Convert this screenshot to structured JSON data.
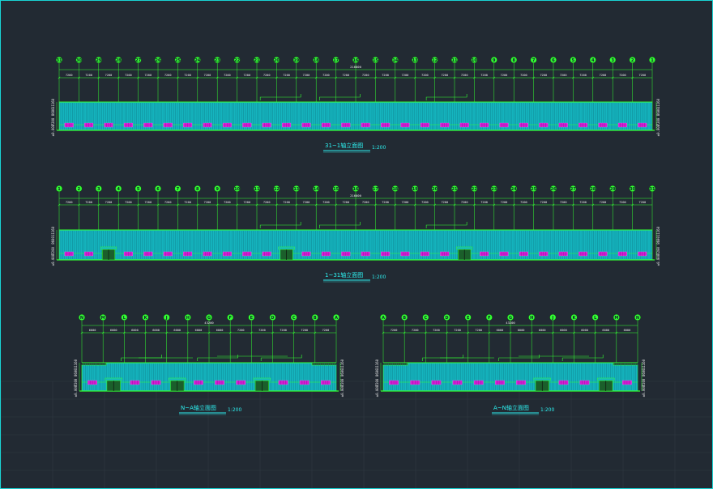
{
  "colors": {
    "background": "#222a33",
    "frame": "#19d4d4",
    "grid_line": "#2f3942",
    "dimension": "#33ff33",
    "wall_fill": "#15b5bf",
    "wall_rib": "#0f7f8a",
    "window": "#d21ed2",
    "door": "#1b5f2b",
    "title": "#2df0f0"
  },
  "elevations": [
    {
      "id": "elev-north",
      "axes": [
        "31",
        "30",
        "29",
        "28",
        "27",
        "26",
        "25",
        "24",
        "23",
        "22",
        "21",
        "20",
        "19",
        "18",
        "17",
        "16",
        "15",
        "14",
        "13",
        "12",
        "11",
        "10",
        "9",
        "8",
        "7",
        "6",
        "5",
        "4",
        "3",
        "2",
        "1"
      ],
      "spacings": [
        "7200",
        "7200",
        "7200",
        "7200",
        "7200",
        "7200",
        "7200",
        "7200",
        "7200",
        "7200",
        "7200",
        "7200",
        "7200",
        "7200",
        "7200",
        "7200",
        "7200",
        "7200",
        "7200",
        "7200",
        "7200",
        "7200",
        "7200",
        "7200",
        "7200",
        "7200",
        "7200",
        "7200",
        "7200",
        "7200"
      ],
      "total": "216000",
      "height_labels": [
        "11160",
        "8600",
        "7200",
        "±0.000"
      ],
      "title": "31~1轴立面图",
      "scale": "1:200",
      "windows": 30,
      "doors": []
    },
    {
      "id": "elev-south",
      "axes": [
        "1",
        "2",
        "3",
        "4",
        "5",
        "6",
        "7",
        "8",
        "9",
        "10",
        "11",
        "12",
        "13",
        "14",
        "15",
        "16",
        "17",
        "18",
        "19",
        "20",
        "21",
        "22",
        "23",
        "24",
        "25",
        "26",
        "27",
        "28",
        "29",
        "30",
        "31"
      ],
      "spacings": [
        "7200",
        "7200",
        "7200",
        "7200",
        "7200",
        "7200",
        "7200",
        "7200",
        "7200",
        "7200",
        "7200",
        "7200",
        "7200",
        "7200",
        "7200",
        "7200",
        "7200",
        "7200",
        "7200",
        "7200",
        "7200",
        "7200",
        "7200",
        "7200",
        "7200",
        "7200",
        "7200",
        "7200",
        "7200",
        "7200"
      ],
      "total": "216000",
      "height_labels": [
        "11160",
        "8600",
        "7200",
        "±0.000"
      ],
      "title": "1~31轴立面图",
      "scale": "1:200",
      "windows": 30,
      "doors": [
        2,
        11,
        20
      ]
    },
    {
      "id": "elev-west",
      "axes": [
        "N",
        "M",
        "L",
        "K",
        "J",
        "H",
        "G",
        "F",
        "E",
        "D",
        "C",
        "B",
        "A"
      ],
      "spacings": [
        "6000",
        "6000",
        "6000",
        "6000",
        "6000",
        "6000",
        "6000",
        "7200",
        "7200",
        "7200",
        "7200",
        "7200"
      ],
      "total": "43200",
      "height_labels": [
        "11160",
        "8600",
        "7200",
        "±0.000"
      ],
      "title": "N~A轴立面图",
      "scale": "1:200",
      "windows": 12,
      "doors": [
        1,
        4,
        8
      ]
    },
    {
      "id": "elev-east",
      "axes": [
        "A",
        "B",
        "C",
        "D",
        "E",
        "F",
        "G",
        "H",
        "J",
        "K",
        "L",
        "M",
        "N"
      ],
      "spacings": [
        "7200",
        "7200",
        "7200",
        "7200",
        "7200",
        "6000",
        "6000",
        "6000",
        "6000",
        "6000",
        "6000",
        "6000"
      ],
      "total": "43200",
      "height_labels": [
        "11160",
        "8600",
        "7200",
        "±0.000"
      ],
      "title": "A~N轴立面图",
      "scale": "1:200",
      "windows": 12,
      "doors": [
        7,
        10
      ]
    }
  ]
}
